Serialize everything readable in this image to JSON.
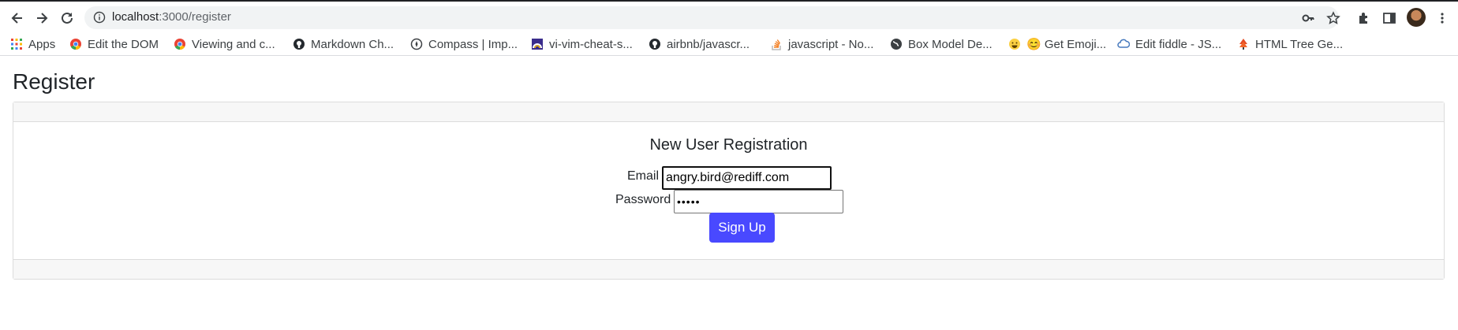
{
  "browser": {
    "url_host": "localhost",
    "url_path": ":3000/register",
    "bookmarks": [
      {
        "label": "Apps",
        "icon": "apps-grid-icon"
      },
      {
        "label": "Edit the DOM",
        "icon": "chrome-icon"
      },
      {
        "label": "Viewing and c...",
        "icon": "chrome-icon"
      },
      {
        "label": "Markdown Ch...",
        "icon": "github-icon"
      },
      {
        "label": "Compass | Imp...",
        "icon": "compass-icon"
      },
      {
        "label": "vi-vim-cheat-s...",
        "icon": "vim-icon"
      },
      {
        "label": "airbnb/javascr...",
        "icon": "github-icon"
      },
      {
        "label": "javascript - No...",
        "icon": "stackoverflow-icon"
      },
      {
        "label": "Box Model De...",
        "icon": "globe-icon"
      },
      {
        "label": "😊 Get Emoji...",
        "icon": "emoji-icon"
      },
      {
        "label": "Edit fiddle - JS...",
        "icon": "jsfiddle-icon"
      },
      {
        "label": "HTML Tree Ge...",
        "icon": "tree-icon"
      }
    ]
  },
  "page": {
    "title": "Register",
    "form": {
      "heading": "New User Registration",
      "email_label": "Email",
      "email_value": "angry.bird@rediff.com",
      "password_label": "Password",
      "password_value": "•••••",
      "submit_label": "Sign Up"
    }
  },
  "colors": {
    "button": "#4949ff",
    "card_header": "#f7f7f7"
  }
}
